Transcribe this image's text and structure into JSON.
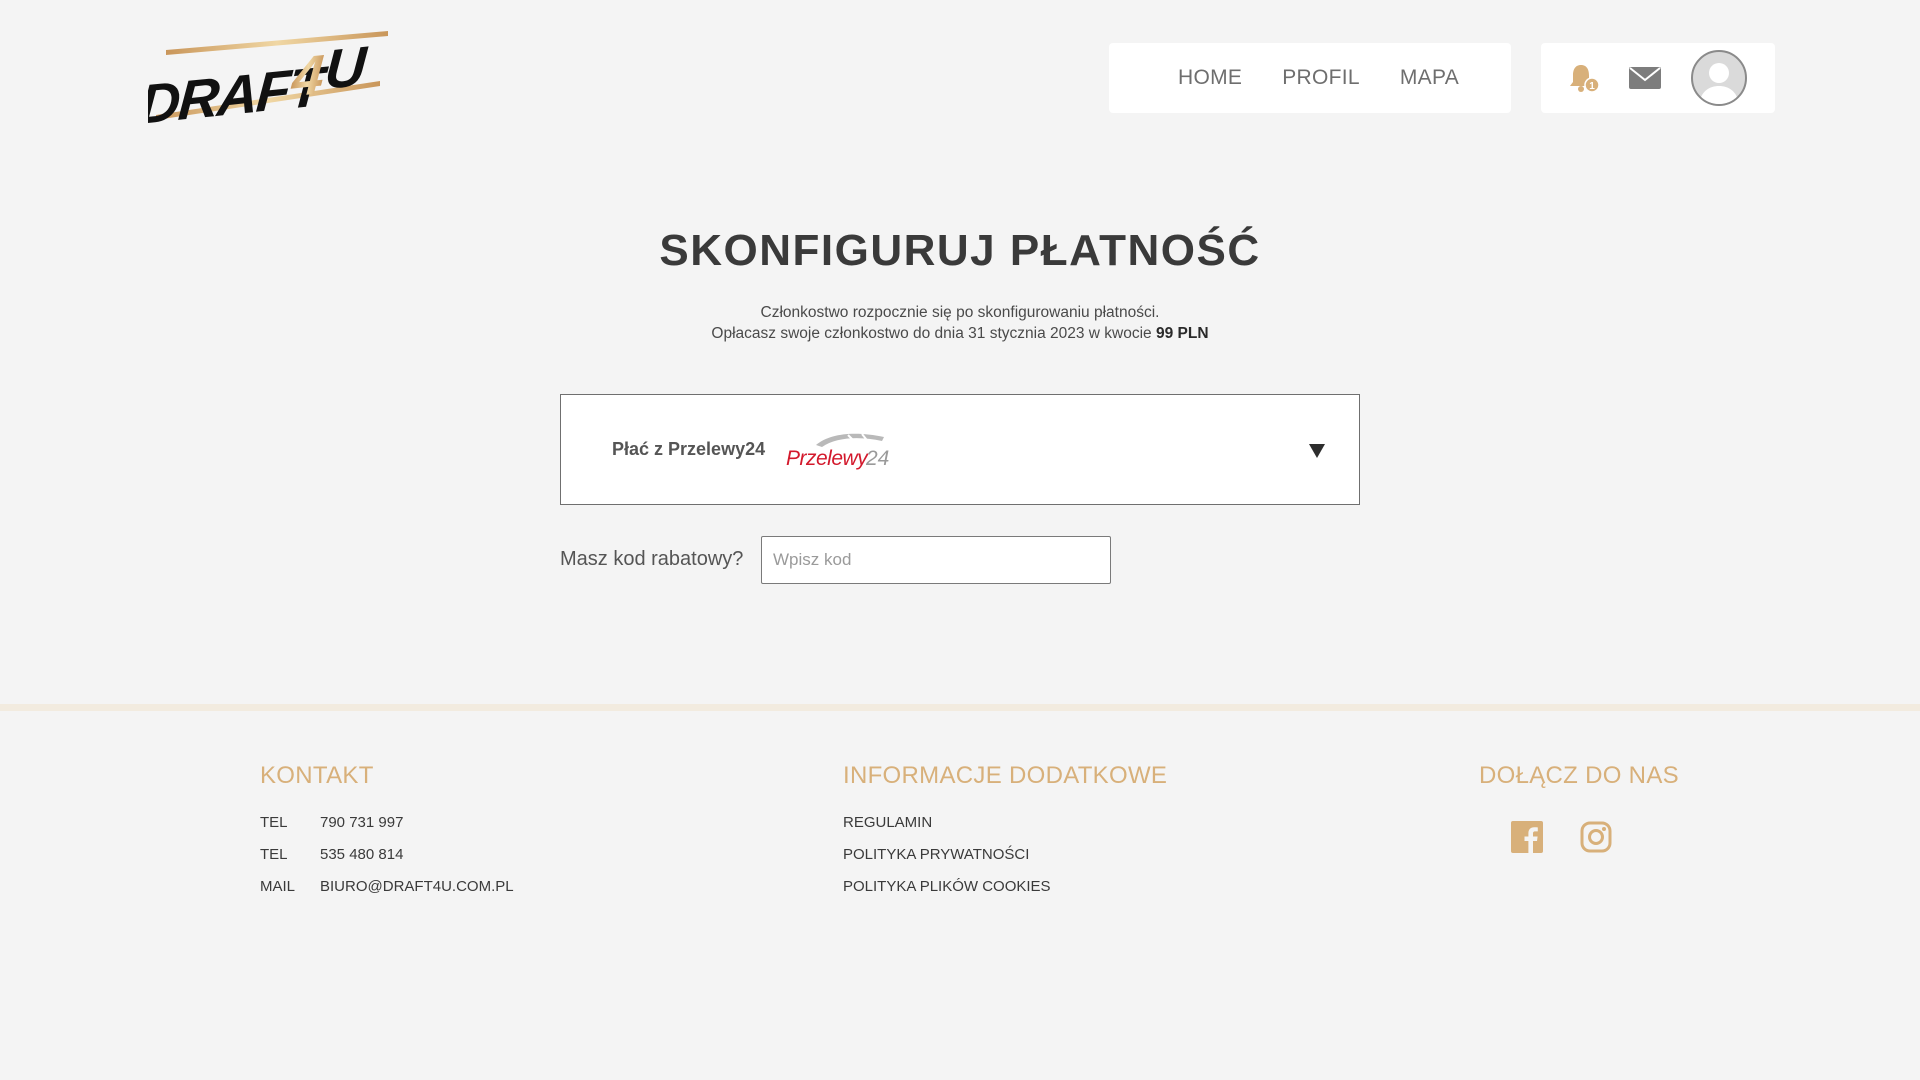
{
  "header": {
    "logo_text": "DRAFT4U",
    "nav": [
      {
        "label": "HOME"
      },
      {
        "label": "PROFIL"
      },
      {
        "label": "MAPA"
      }
    ],
    "notifications_count": "1",
    "accent_color": "#d8b07a"
  },
  "main": {
    "title": "SKONFIGURUJ PŁATNOŚĆ",
    "subtitle_line1": "Członkostwo rozpocznie się po skonfigurowaniu płatności.",
    "subtitle_line2": "Opłacasz swoje członkostwo do dnia 31 stycznia 2023 w kwocie",
    "amount": "99 PLN",
    "payment_method": {
      "label": "Płać z Przelewy24",
      "logo_text": "Przelewy24"
    },
    "discount": {
      "label": "Masz kod rabatowy?",
      "placeholder": "Wpisz kod"
    }
  },
  "footer": {
    "contact": {
      "heading": "KONTAKT",
      "rows": [
        {
          "key": "TEL",
          "value": "790 731 997"
        },
        {
          "key": "TEL",
          "value": "535 480 814"
        },
        {
          "key": "MAIL",
          "value": "BIURO@DRAFT4U.COM.PL"
        }
      ]
    },
    "info": {
      "heading": "INFORMACJE DODATKOWE",
      "links": [
        "REGULAMIN",
        "POLITYKA PRYWATNOŚCI",
        "POLITYKA PLIKÓW COOKIES"
      ]
    },
    "social": {
      "heading": "DOŁĄCZ DO NAS",
      "icons": [
        "facebook-icon",
        "instagram-icon"
      ]
    }
  }
}
